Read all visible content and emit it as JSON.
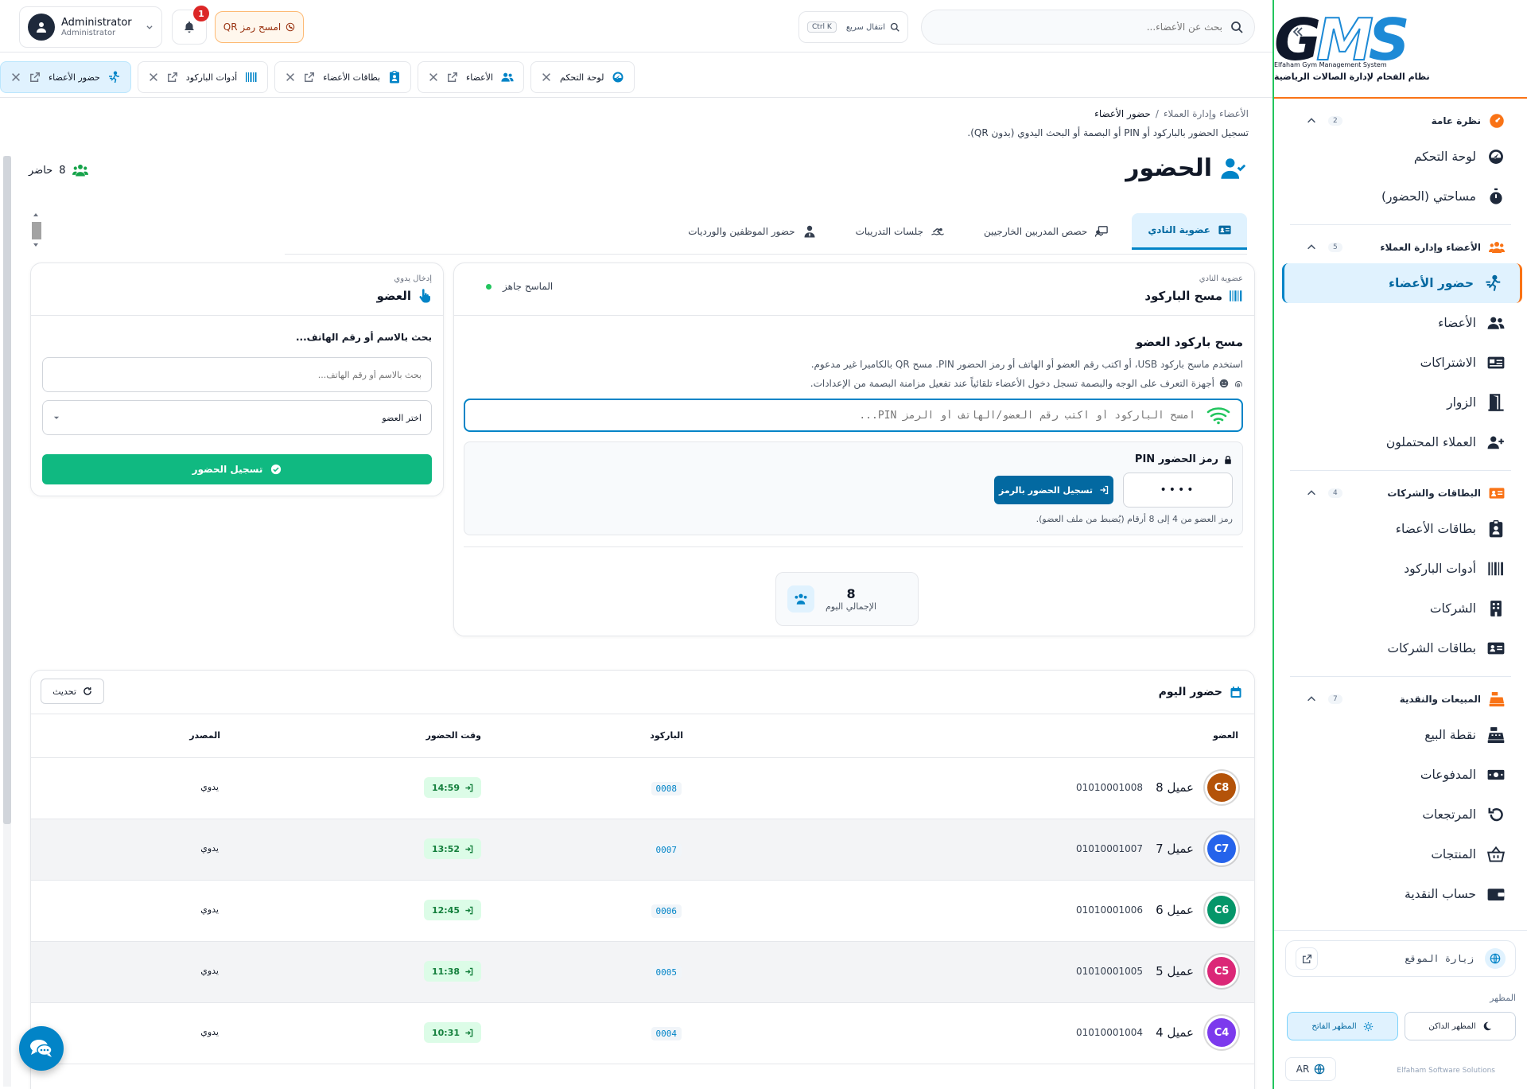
{
  "app": {
    "logo_text": "GMS",
    "logo_sub_en": "Elfaham Gym Management System",
    "logo_sub_ar": "نظام الفحام لإدارة الصالات الرياضية"
  },
  "sidebar": {
    "sections": [
      {
        "title": "نظرة عامة",
        "count": "2",
        "items": [
          {
            "label": "لوحة التحكم",
            "icon": "dashboard-icon"
          },
          {
            "label": "مساحتي (الحضور)",
            "icon": "stopwatch-icon"
          }
        ]
      },
      {
        "title": "الأعضاء وإدارة العملاء",
        "count": "5",
        "items": [
          {
            "label": "حضور الأعضاء",
            "icon": "member-attendance-icon",
            "active": true
          },
          {
            "label": "الأعضاء",
            "icon": "members-icon"
          },
          {
            "label": "الاشتراكات",
            "icon": "subscriptions-icon"
          },
          {
            "label": "الزوار",
            "icon": "door-icon"
          },
          {
            "label": "العملاء المحتملون",
            "icon": "user-plus-icon"
          }
        ]
      },
      {
        "title": "البطاقات والشركات",
        "count": "4",
        "items": [
          {
            "label": "بطاقات الأعضاء",
            "icon": "id-badge-icon"
          },
          {
            "label": "أدوات الباركود",
            "icon": "barcode-icon"
          },
          {
            "label": "الشركات",
            "icon": "building-icon"
          },
          {
            "label": "بطاقات الشركات",
            "icon": "address-card-icon"
          }
        ]
      },
      {
        "title": "المبيعات والنقدية",
        "count": "7",
        "items": [
          {
            "label": "نقطة البيع",
            "icon": "cash-register-icon"
          },
          {
            "label": "المدفوعات",
            "icon": "money-icon"
          },
          {
            "label": "المرتجعات",
            "icon": "undo-icon"
          },
          {
            "label": "المنتجات",
            "icon": "basket-icon"
          },
          {
            "label": "حساب النقدية",
            "icon": "wallet-icon"
          }
        ]
      }
    ],
    "visit_site": "زيارة الموقع",
    "appearance_label": "المظهر",
    "theme_dark": "المظهر الداكن",
    "theme_light": "المظهر الفاتح",
    "lang": "AR",
    "copyright": "Elfaham Software Solutions"
  },
  "topbar": {
    "search_placeholder": "بحث عن الأعضاء...",
    "quick_nav": "انتقال سريع",
    "quick_nav_kbd": "Ctrl K",
    "qr_button": "امسح رمز QR",
    "notifications_count": "1",
    "user_name": "Administrator",
    "user_role": "Administrator"
  },
  "tabs": [
    {
      "label": "لوحة التحكم",
      "icon": "dashboard-icon",
      "active": false,
      "has_ext": false
    },
    {
      "label": "الأعضاء",
      "icon": "members-icon",
      "active": false,
      "has_ext": true
    },
    {
      "label": "بطاقات الأعضاء",
      "icon": "id-badge-icon",
      "active": false,
      "has_ext": true
    },
    {
      "label": "أدوات الباركود",
      "icon": "barcode-icon",
      "active": false,
      "has_ext": true
    },
    {
      "label": "حضور الأعضاء",
      "icon": "member-attendance-icon",
      "active": true,
      "has_ext": true
    }
  ],
  "breadcrumb": {
    "parent": "الأعضاء وإدارة العملاء",
    "separator": "/",
    "current": "حضور الأعضاء"
  },
  "page": {
    "description": "تسجيل الحضور بالباركود أو PIN أو البصمة أو البحث اليدوي (بدون QR).",
    "title": "الحضور",
    "present_count": "8",
    "present_label": "حاضر"
  },
  "module_tabs": [
    {
      "label": "عضوية النادي",
      "icon": "id-card-icon",
      "active": true
    },
    {
      "label": "حصص المدربين الخارجيين",
      "icon": "trainer-icon",
      "active": false
    },
    {
      "label": "جلسات التدريبات",
      "icon": "swimmer-icon",
      "active": false
    },
    {
      "label": "حضور الموظفين والورديات",
      "icon": "staff-icon",
      "active": false
    }
  ],
  "scan_card": {
    "subtitle": "عضوية النادي",
    "title": "مسح الباركود",
    "scanner_status": "الماسح جاهز",
    "heading": "مسح باركود العضو",
    "help1": "استخدم ماسح باركود USB، أو اكتب رقم العضو أو الهاتف أو رمز الحضور PIN. مسح QR بالكاميرا غير مدعوم.",
    "help2": "أجهزة التعرف على الوجه والبصمة تسجل دخول الأعضاء تلقائياً عند تفعيل مزامنة البصمة من الإعدادات.",
    "input_placeholder": "امسح الباركود أو اكتب رقم العضو/الهاتف أو الرمز PIN...",
    "pin_title": "رمز الحضور PIN",
    "pin_value": "••••",
    "pin_button": "تسجيل الحضور بالرمز",
    "pin_hint": "رمز العضو من 4 إلى 8 أرقام (يُضبط من ملف العضو).",
    "total_value": "8",
    "total_label": "الإجمالي اليوم"
  },
  "manual_card": {
    "subtitle": "إدخال يدوي",
    "title": "العضو",
    "search_label": "بحث بالاسم أو رقم الهاتف...",
    "search_placeholder": "بحث بالاسم أو رقم الهاتف...",
    "select_placeholder": "اختر العضو",
    "submit": "تسجيل الحضور"
  },
  "today": {
    "title": "حضور اليوم",
    "refresh": "تحديث",
    "columns": {
      "member": "العضو",
      "barcode": "الباركود",
      "time": "وقت الحضور",
      "source": "المصدر"
    },
    "rows": [
      {
        "initials": "C8",
        "name": "عميل 8",
        "phone": "01010001008",
        "barcode": "0008",
        "time": "14:59",
        "source": "يدوي",
        "color": "#b45309"
      },
      {
        "initials": "C7",
        "name": "عميل 7",
        "phone": "01010001007",
        "barcode": "0007",
        "time": "13:52",
        "source": "يدوي",
        "color": "#2563eb"
      },
      {
        "initials": "C6",
        "name": "عميل 6",
        "phone": "01010001006",
        "barcode": "0006",
        "time": "12:45",
        "source": "يدوي",
        "color": "#059669"
      },
      {
        "initials": "C5",
        "name": "عميل 5",
        "phone": "01010001005",
        "barcode": "0005",
        "time": "11:38",
        "source": "يدوي",
        "color": "#db2777"
      },
      {
        "initials": "C4",
        "name": "عميل 4",
        "phone": "01010001004",
        "barcode": "0004",
        "time": "10:31",
        "source": "يدوي",
        "color": "#7c3aed"
      }
    ]
  }
}
